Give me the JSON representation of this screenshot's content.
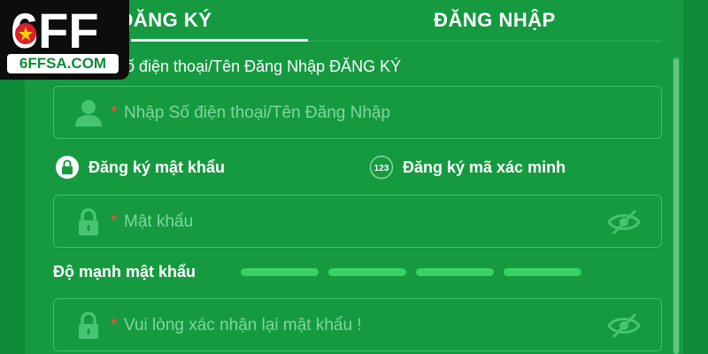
{
  "logo": {
    "mark_text": "6FF",
    "domain": "6FFSA.COM"
  },
  "tabs": {
    "register": "ĐĂNG KÝ",
    "login": "ĐĂNG NHẬP",
    "active": "register"
  },
  "form": {
    "account_label": "Số điện thoại/Tên Đăng Nhập ĐĂNG KÝ",
    "username": {
      "required_mark": "*",
      "placeholder": "Nhập Số điện thoại/Tên Đăng Nhập",
      "icon": "user-icon"
    },
    "modes": [
      {
        "label": "Đăng ký mật khẩu",
        "icon": "lock-icon",
        "selected": true
      },
      {
        "label": "Đăng ký mã xác minh",
        "icon": "numeric-code-icon",
        "icon_text": "123",
        "selected": false
      }
    ],
    "password": {
      "required_mark": "*",
      "placeholder": "Mật khẩu",
      "icon": "lock-icon",
      "toggle_icon": "eye-off-icon"
    },
    "strength": {
      "label": "Độ mạnh mật khẩu",
      "segments": 4
    },
    "confirm": {
      "required_mark": "*",
      "placeholder": "Vui lòng xác nhận lại mật khẩu !",
      "icon": "lock-icon",
      "toggle_icon": "eye-off-icon"
    }
  },
  "colors": {
    "panel": "#159a40",
    "logo_bg": "#0d0d0d",
    "accent": "#3fbe68",
    "placeholder": "#7fd79a",
    "required": "#ff4a4a",
    "flag_red": "#d8212b",
    "flag_star": "#ffd200"
  }
}
